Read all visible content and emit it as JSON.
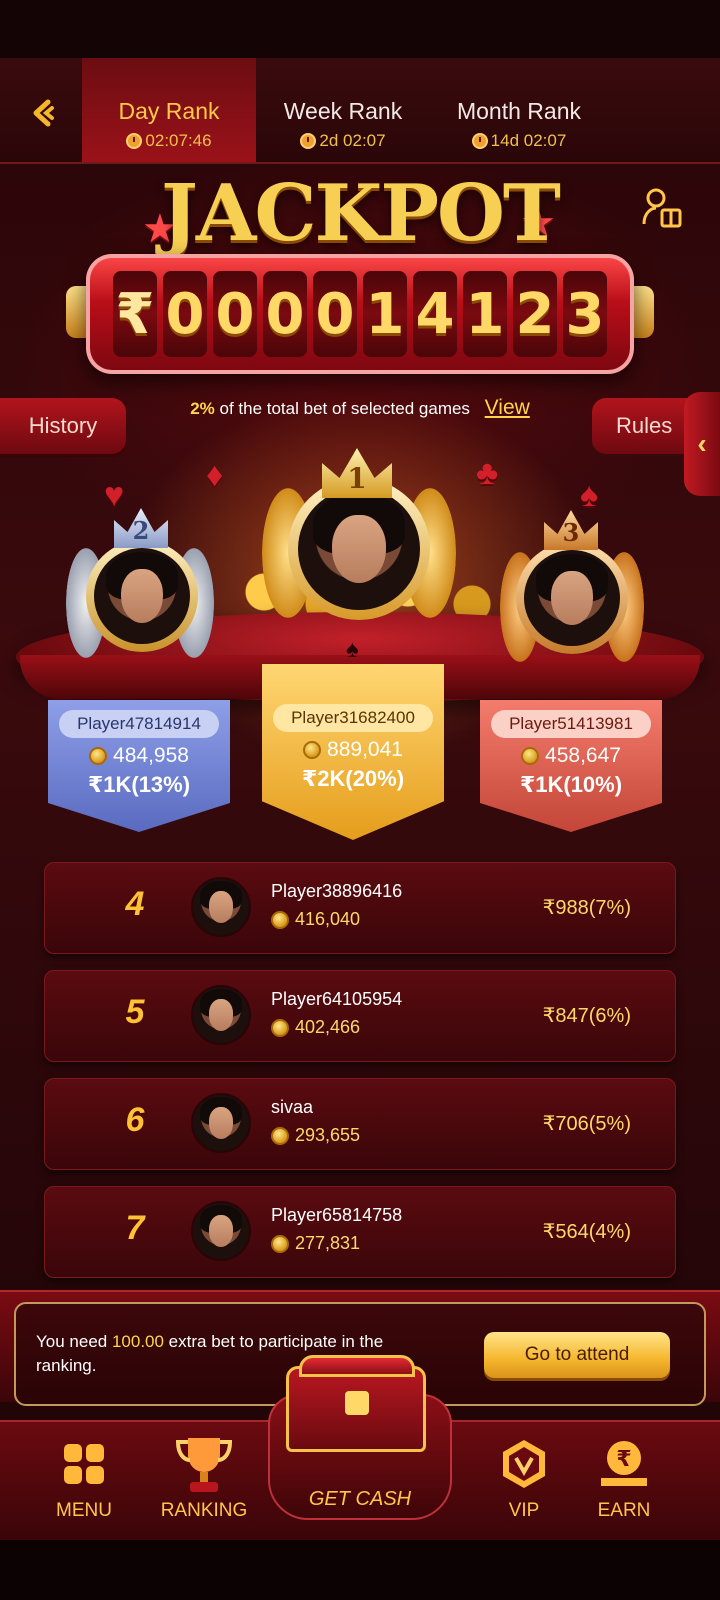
{
  "header": {
    "tabs": [
      {
        "label": "Day Rank",
        "countdown": "02:07:46",
        "active": true
      },
      {
        "label": "Week Rank",
        "countdown": "2d 02:07",
        "active": false
      },
      {
        "label": "Month Rank",
        "countdown": "14d 02:07",
        "active": false
      }
    ]
  },
  "jackpot": {
    "title": "JACKPOT",
    "currency": "₹",
    "digits": [
      "0",
      "0",
      "0",
      "0",
      "1",
      "4",
      "1",
      "2",
      "3"
    ]
  },
  "info": {
    "percent": "2%",
    "text": "of the total bet of selected games",
    "view_label": "View"
  },
  "side_buttons": {
    "history": "History",
    "rules": "Rules"
  },
  "podium": [
    {
      "rank": "2",
      "name": "Player47814914",
      "score": "484,958",
      "prize": "₹1K(13%)"
    },
    {
      "rank": "1",
      "name": "Player31682400",
      "score": "889,041",
      "prize": "₹2K(20%)"
    },
    {
      "rank": "3",
      "name": "Player51413981",
      "score": "458,647",
      "prize": "₹1K(10%)"
    }
  ],
  "rows": [
    {
      "rank": "4",
      "name": "Player38896416",
      "score": "416,040",
      "prize": "₹988(7%)"
    },
    {
      "rank": "5",
      "name": "Player64105954",
      "score": "402,466",
      "prize": "₹847(6%)"
    },
    {
      "rank": "6",
      "name": "sivaa",
      "score": "293,655",
      "prize": "₹706(5%)"
    },
    {
      "rank": "7",
      "name": "Player65814758",
      "score": "277,831",
      "prize": "₹564(4%)"
    }
  ],
  "notice": {
    "prefix": "You need ",
    "amount": "100.00",
    "suffix": " extra bet to participate in the ranking.",
    "button": "Go to attend"
  },
  "nav": {
    "menu": "MENU",
    "ranking": "RANKING",
    "get_cash": "GET CASH",
    "vip": "VIP",
    "earn": "EARN"
  },
  "colors": {
    "accent_gold": "#ffc64a",
    "bg_red": "#6a0a10",
    "silver": "#8a9ce0",
    "gold": "#f5b62c",
    "bronze": "#e0685a"
  }
}
